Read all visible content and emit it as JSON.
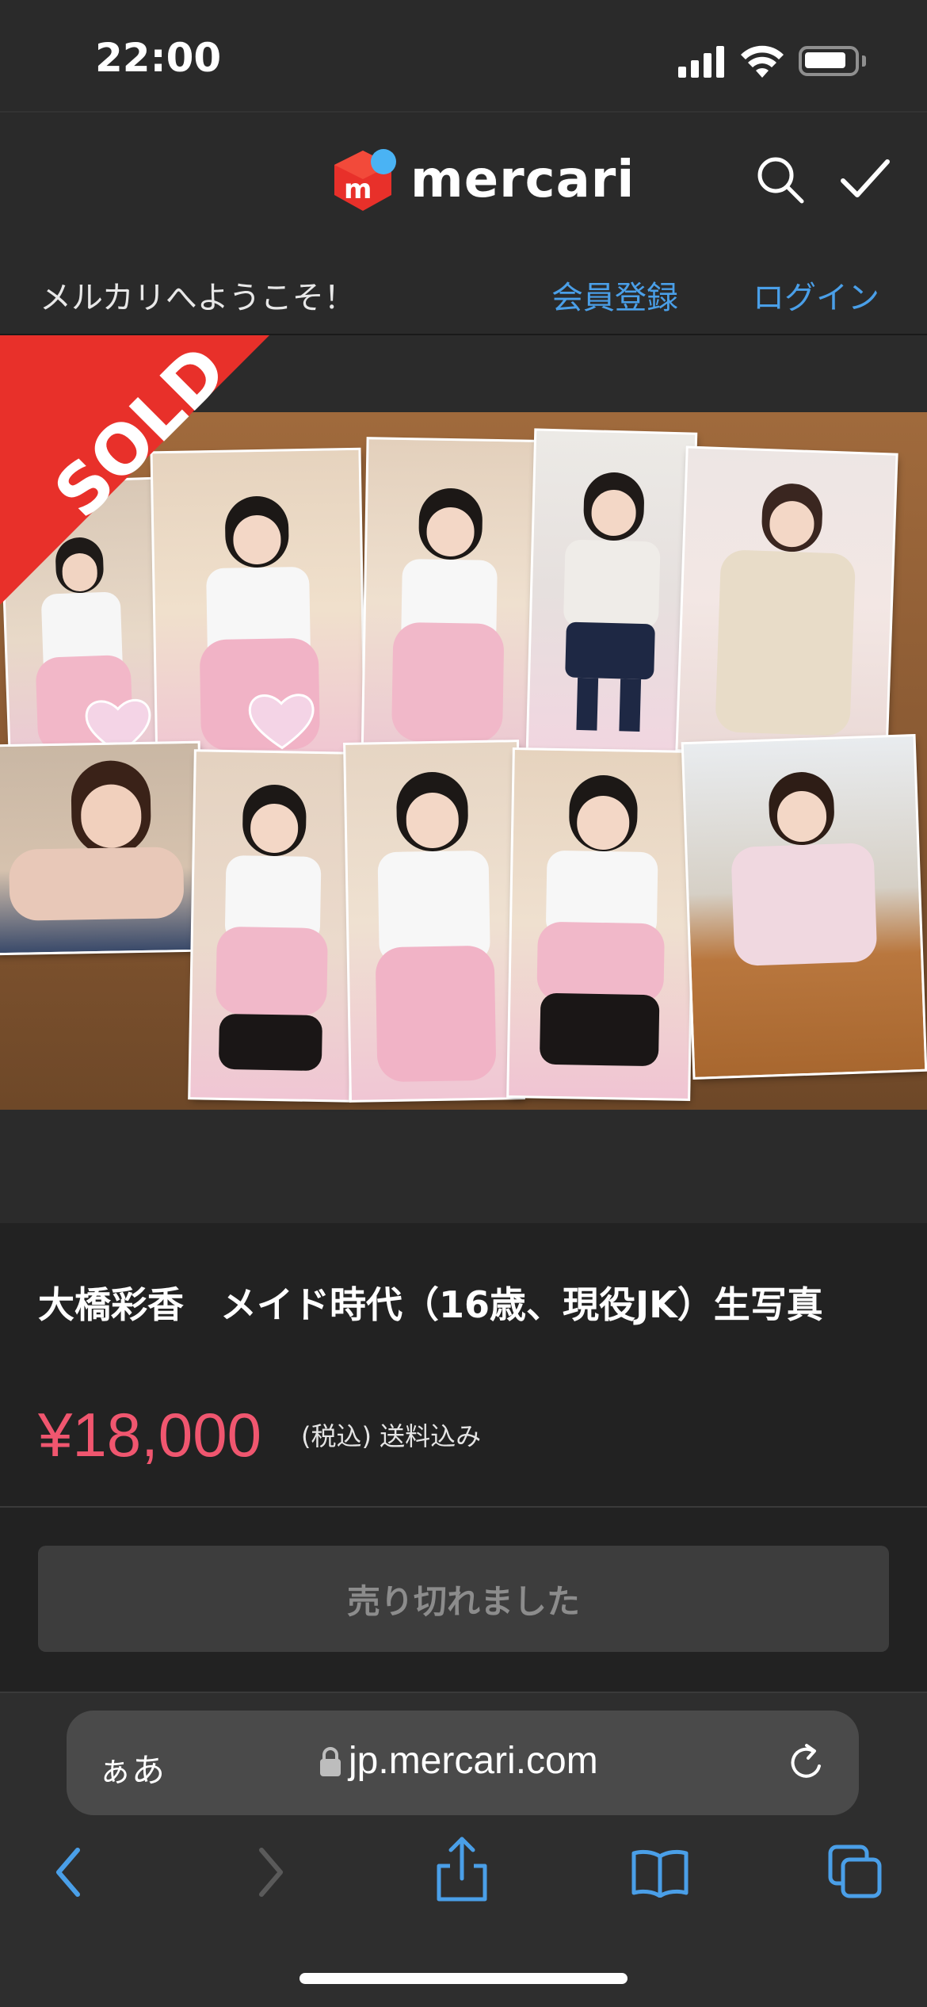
{
  "status_bar": {
    "time": "22:00",
    "battery_level": 0.85
  },
  "header": {
    "logo_text": "mercari",
    "logo_icon": "mercari-logo-icon"
  },
  "welcome": {
    "text": "メルカリへようこそ！",
    "signup": "会員登録",
    "login": "ログイン"
  },
  "listing": {
    "badge": "SOLD",
    "title": "大橋彩香　メイド時代（16歳、現役JK）生写真",
    "price": "¥18,000",
    "price_note": "(税込) 送料込み",
    "button": "売り切れました"
  },
  "browser": {
    "text_size": "ぁあ",
    "url": "jp.mercari.com"
  },
  "colors": {
    "price": "#f0566f",
    "link": "#4a9fe8",
    "sold_ribbon": "#e8302a",
    "brand_red": "#e8302a",
    "brand_blue": "#4ab3f4"
  }
}
